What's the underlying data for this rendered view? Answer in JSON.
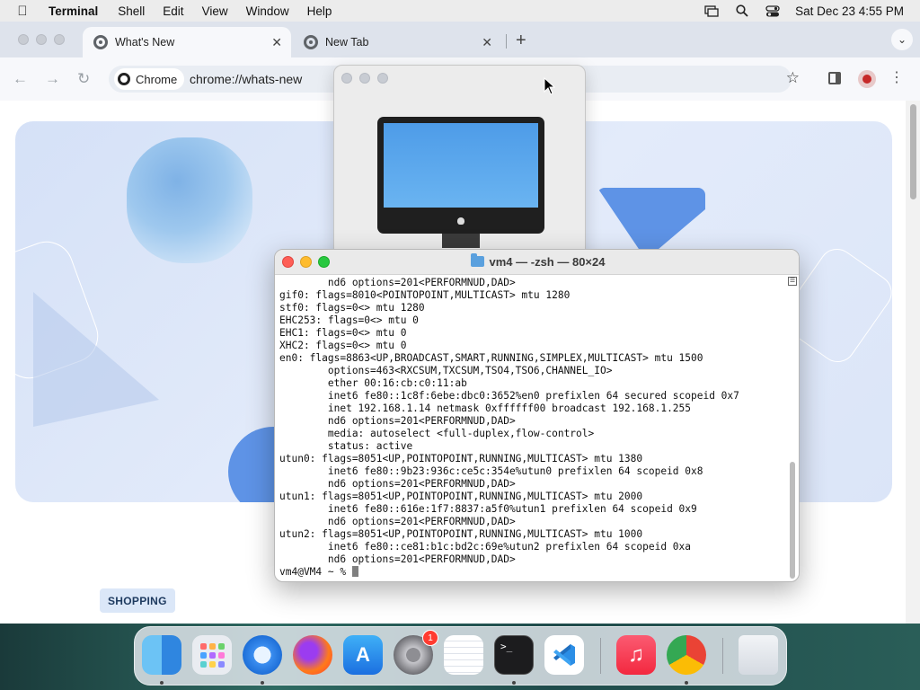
{
  "menubar": {
    "app_name": "Terminal",
    "items": [
      "Shell",
      "Edit",
      "View",
      "Window",
      "Help"
    ],
    "clock": "Sat Dec 23  4:55 PM"
  },
  "chrome": {
    "tabs": [
      {
        "title": "What's New",
        "active": true
      },
      {
        "title": "New Tab",
        "active": false
      }
    ],
    "chip_label": "Chrome",
    "url": "chrome://whats-new",
    "shopping_label": "SHOPPING"
  },
  "terminal": {
    "title": "vm4 — -zsh — 80×24",
    "lines": [
      "        nd6 options=201<PERFORMNUD,DAD>",
      "gif0: flags=8010<POINTOPOINT,MULTICAST> mtu 1280",
      "stf0: flags=0<> mtu 1280",
      "EHC253: flags=0<> mtu 0",
      "EHC1: flags=0<> mtu 0",
      "XHC2: flags=0<> mtu 0",
      "en0: flags=8863<UP,BROADCAST,SMART,RUNNING,SIMPLEX,MULTICAST> mtu 1500",
      "        options=463<RXCSUM,TXCSUM,TSO4,TSO6,CHANNEL_IO>",
      "        ether 00:16:cb:c0:11:ab",
      "        inet6 fe80::1c8f:6ebe:dbc0:3652%en0 prefixlen 64 secured scopeid 0x7",
      "        inet 192.168.1.14 netmask 0xffffff00 broadcast 192.168.1.255",
      "        nd6 options=201<PERFORMNUD,DAD>",
      "        media: autoselect <full-duplex,flow-control>",
      "        status: active",
      "utun0: flags=8051<UP,POINTOPOINT,RUNNING,MULTICAST> mtu 1380",
      "        inet6 fe80::9b23:936c:ce5c:354e%utun0 prefixlen 64 scopeid 0x8",
      "        nd6 options=201<PERFORMNUD,DAD>",
      "utun1: flags=8051<UP,POINTOPOINT,RUNNING,MULTICAST> mtu 2000",
      "        inet6 fe80::616e:1f7:8837:a5f0%utun1 prefixlen 64 scopeid 0x9",
      "        nd6 options=201<PERFORMNUD,DAD>",
      "utun2: flags=8051<UP,POINTOPOINT,RUNNING,MULTICAST> mtu 1000",
      "        inet6 fe80::ce81:b1c:bd2c:69e%utun2 prefixlen 64 scopeid 0xa",
      "        nd6 options=201<PERFORMNUD,DAD>"
    ],
    "prompt": "vm4@VM4 ~ % "
  },
  "dock": {
    "items": [
      {
        "name": "finder-icon",
        "running": true
      },
      {
        "name": "launchpad-icon",
        "running": false
      },
      {
        "name": "safari-icon",
        "running": true
      },
      {
        "name": "firefox-icon",
        "running": false
      },
      {
        "name": "app-store-icon",
        "running": false
      },
      {
        "name": "system-settings-icon",
        "running": false,
        "badge": "1"
      },
      {
        "name": "textedit-icon",
        "running": false
      },
      {
        "name": "terminal-icon",
        "running": true
      },
      {
        "name": "vscode-icon",
        "running": false
      },
      {
        "name": "music-icon",
        "running": false
      },
      {
        "name": "chrome-icon",
        "running": true
      },
      {
        "name": "trash-icon",
        "running": false
      }
    ],
    "system_settings_badge": "1"
  },
  "colors": {
    "accent_blue": "#5e93e6",
    "terminal_red": "#fe5f57",
    "terminal_yellow": "#febc2e",
    "terminal_green": "#28c840"
  }
}
